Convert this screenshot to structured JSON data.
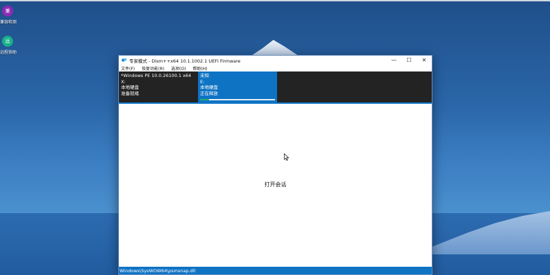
{
  "desktop": {
    "icons": [
      {
        "label": "兼容检测",
        "glyph": "兼",
        "color": "#8b2bb5",
        "icon": "app-icon"
      },
      {
        "label": "远程协助",
        "glyph": "远",
        "color": "#17b08a",
        "icon": "app-icon"
      }
    ]
  },
  "window": {
    "title": "专家模式 - Dism++x64 10.1.1002.1 UEFI Firmware",
    "controls": {
      "minimize": "—",
      "maximize": "☐",
      "close": "✕"
    },
    "menu": [
      "文件(F)",
      "恢复功能(R)",
      "选项(O)",
      "帮助(H)"
    ],
    "sessions": [
      {
        "lines": [
          "*Windows PE 10.0.26100.1 x64",
          "X:",
          "本地硬盘",
          "准备就绪"
        ],
        "active": false
      },
      {
        "lines": [
          "未知",
          "E:",
          "本地硬盘",
          "正在释放"
        ],
        "active": true,
        "progress": 0.12
      }
    ],
    "content_text": "打开会话",
    "status_text": "Windows\\SysWOW64\\psmsnap.dll"
  },
  "colors": {
    "accent": "#0f73c4",
    "progress": "#27ae60",
    "session_bg": "#232323"
  }
}
